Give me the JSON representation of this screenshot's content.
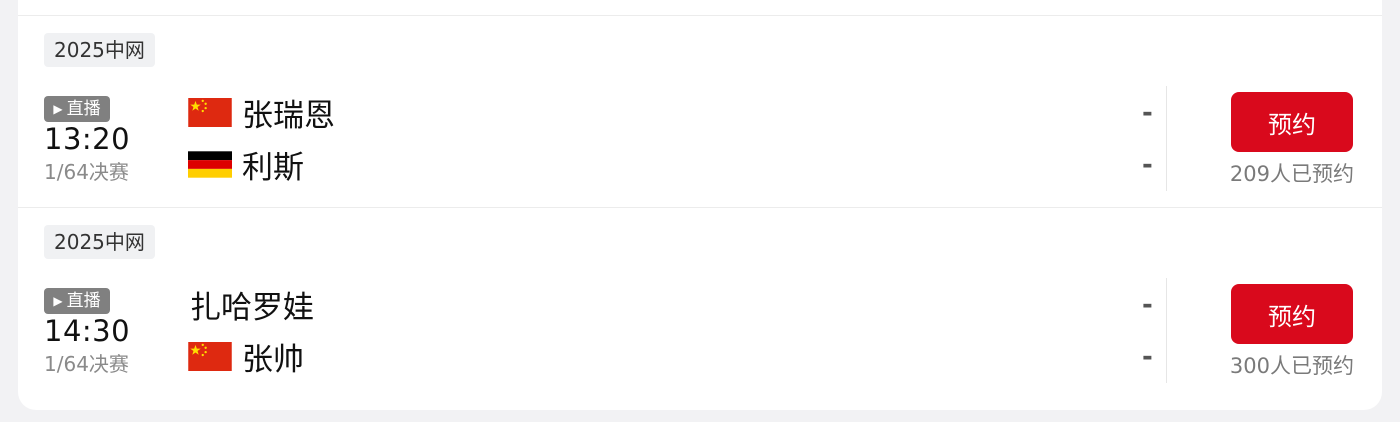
{
  "matches": [
    {
      "tournament": "2025中网",
      "live_label": "直播",
      "time": "13:20",
      "round": "1/64决赛",
      "players": [
        {
          "name": "张瑞恩",
          "flag": "china-flag-icon",
          "score": "-"
        },
        {
          "name": "利斯",
          "flag": "germany-flag-icon",
          "score": "-"
        }
      ],
      "button_label": "预约",
      "booking_count": "209人已预约"
    },
    {
      "tournament": "2025中网",
      "live_label": "直播",
      "time": "14:30",
      "round": "1/64决赛",
      "players": [
        {
          "name": "扎哈罗娃",
          "flag": "",
          "score": "-"
        },
        {
          "name": "张帅",
          "flag": "china-flag-icon",
          "score": "-"
        }
      ],
      "button_label": "预约",
      "booking_count": "300人已预约"
    }
  ],
  "colors": {
    "accent": "#d9091c",
    "badge_bg": "#808080",
    "tag_bg": "#f0f1f3"
  }
}
